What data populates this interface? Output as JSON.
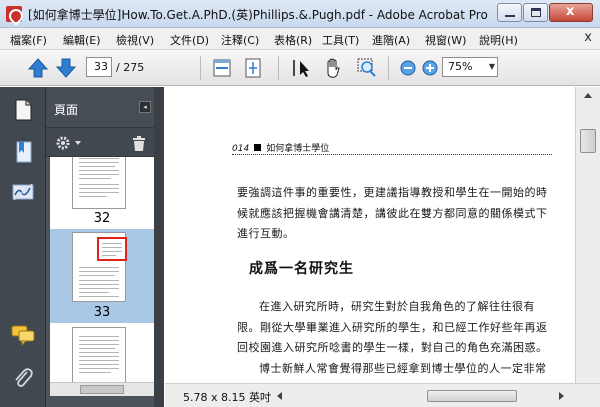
{
  "window": {
    "title": "[如何拿博士學位]How.To.Get.A.PhD.(英)Phillips.&.Pugh.pdf - Adobe Acrobat Pro",
    "close_glyph": "x"
  },
  "menu": {
    "items": [
      "檔案(F)",
      "編輯(E)",
      "檢視(V)",
      "文件(D)",
      "注釋(C)",
      "表格(R)",
      "工具(T)",
      "進階(A)",
      "視窗(W)",
      "說明(H)"
    ],
    "close_glyph": "x"
  },
  "toolbar": {
    "current_page": "33",
    "total_pages": "/ 275",
    "zoom": "75%",
    "zoom_dropdown": "▼"
  },
  "pane": {
    "title": "頁面",
    "collapse_glyph": "◂",
    "thumbnails": [
      {
        "label": "32"
      },
      {
        "label": "33"
      }
    ]
  },
  "document": {
    "running_head_num": "014",
    "running_head_title": "如何拿博士學位",
    "para1": "要強調這件事的重要性，更建議指導教授和學生在一開始的時候就應該把握機會講清楚，講彼此在雙方都同意的關係模式下進行互動。",
    "heading": "成爲一名研究生",
    "para2": "在進入研究所時，研究生對於自我角色的了解往往很有限。剛從大學畢業進入研究所的學生，和已經工作好些年再返回校園進入研究所唸書的學生一樣，對自己的角色充滿困惑。",
    "para3": "博士新鮮人常會覺得那些已經拿到博士學位的人一定非常優秀聰明，同時也覺得自己好像並不是那麼聰明，這種對自我"
  },
  "status": {
    "page_size": "5.78 x 8.15 英吋"
  },
  "colors": {
    "selection": "#a9c8e6",
    "nav_dark": "#42484f",
    "view_rect": "#e2231a",
    "arrow_blue": "#2f7fd1"
  }
}
